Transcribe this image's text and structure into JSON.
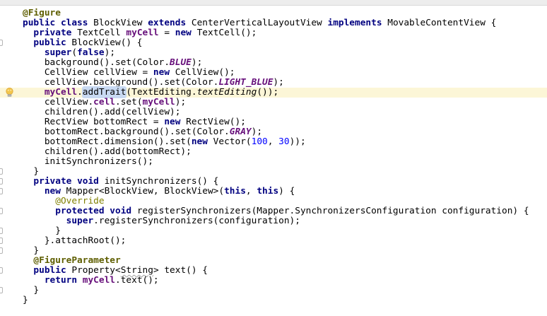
{
  "editor": {
    "language": "java",
    "caret_line_number": 9,
    "colors": {
      "plain": "#000000",
      "keyword": "#000080",
      "field": "#660E7A",
      "static_field_italic": "#660E7A",
      "number": "#0000FF",
      "annotation": "#808000",
      "annotation_strong": "#5E5E00",
      "caret_line_bg": "#FCF6D7",
      "usage_highlight_bg": "#C8D9F2",
      "top_strip_bg": "#EDEDED",
      "editor_bg": "#FFFFFF",
      "bulb_glass": "#F3C64B",
      "bulb_base": "#9B9B9B"
    },
    "gutter": {
      "bulb_icon": "intention-lightbulb",
      "fold_marker_icon": "fold-region-marker"
    },
    "lines": [
      {
        "n": 1,
        "tokens": [
          [
            "@Figure",
            "ab"
          ]
        ]
      },
      {
        "n": 2,
        "tokens": [
          [
            "public ",
            "k"
          ],
          [
            "class ",
            "k"
          ],
          [
            "BlockView ",
            ""
          ],
          [
            "extends ",
            "k"
          ],
          [
            "CenterVerticalLayoutView ",
            ""
          ],
          [
            "implements ",
            "k"
          ],
          [
            "MovableContentView {",
            ""
          ]
        ]
      },
      {
        "n": 3,
        "tokens": [
          [
            "  ",
            ""
          ],
          [
            "private ",
            "k"
          ],
          [
            "TextCell ",
            ""
          ],
          [
            "myCell",
            "f"
          ],
          [
            " = ",
            ""
          ],
          [
            "new ",
            "k"
          ],
          [
            "TextCell();",
            ""
          ]
        ]
      },
      {
        "n": 4,
        "fold": true,
        "tokens": [
          [
            "  ",
            ""
          ],
          [
            "public ",
            "k"
          ],
          [
            "BlockView() {",
            ""
          ]
        ]
      },
      {
        "n": 5,
        "tokens": [
          [
            "    ",
            ""
          ],
          [
            "super",
            "k"
          ],
          [
            "(",
            ""
          ],
          [
            "false",
            "k"
          ],
          [
            ");",
            ""
          ]
        ]
      },
      {
        "n": 6,
        "tokens": [
          [
            "    background().set(Color.",
            ""
          ],
          [
            "BLUE",
            "sf"
          ],
          [
            ");",
            ""
          ]
        ]
      },
      {
        "n": 7,
        "tokens": [
          [
            "    CellView cellView = ",
            ""
          ],
          [
            "new ",
            "k"
          ],
          [
            "CellView();",
            ""
          ]
        ]
      },
      {
        "n": 8,
        "tokens": [
          [
            "    cellView.background().set(Color.",
            ""
          ],
          [
            "LIGHT_BLUE",
            "sf"
          ],
          [
            ");",
            ""
          ]
        ]
      },
      {
        "n": 9,
        "caret": true,
        "bulb": true,
        "tokens": [
          [
            "    ",
            ""
          ],
          [
            "myCell",
            "f"
          ],
          [
            ".",
            ""
          ],
          [
            "addTrait",
            "hl"
          ],
          [
            "(TextEditing.",
            ""
          ],
          [
            "textEditing",
            "sm"
          ],
          [
            "());",
            ""
          ]
        ]
      },
      {
        "n": 10,
        "tokens": [
          [
            "    cellView.",
            ""
          ],
          [
            "cell",
            "f"
          ],
          [
            ".set(",
            ""
          ],
          [
            "myCell",
            "f"
          ],
          [
            ");",
            ""
          ]
        ]
      },
      {
        "n": 11,
        "tokens": [
          [
            "    children().add(cellView);",
            ""
          ]
        ]
      },
      {
        "n": 12,
        "tokens": [
          [
            "    RectView bottomRect = ",
            ""
          ],
          [
            "new ",
            "k"
          ],
          [
            "RectView();",
            ""
          ]
        ]
      },
      {
        "n": 13,
        "tokens": [
          [
            "    bottomRect.background().set(Color.",
            ""
          ],
          [
            "GRAY",
            "sf"
          ],
          [
            ");",
            ""
          ]
        ]
      },
      {
        "n": 14,
        "tokens": [
          [
            "    bottomRect.dimension().set(",
            ""
          ],
          [
            "new ",
            "k"
          ],
          [
            "Vector(",
            ""
          ],
          [
            "100",
            "n"
          ],
          [
            ", ",
            ""
          ],
          [
            "30",
            "n"
          ],
          [
            "));",
            ""
          ]
        ]
      },
      {
        "n": 15,
        "tokens": [
          [
            "    children().add(bottomRect);",
            ""
          ]
        ]
      },
      {
        "n": 16,
        "tokens": [
          [
            "    initSynchronizers();",
            ""
          ]
        ]
      },
      {
        "n": 17,
        "fold": true,
        "tokens": [
          [
            "  }",
            ""
          ]
        ]
      },
      {
        "n": 18,
        "fold": true,
        "tokens": [
          [
            "  ",
            ""
          ],
          [
            "private ",
            "k"
          ],
          [
            "void ",
            "k"
          ],
          [
            "initSynchronizers() {",
            ""
          ]
        ]
      },
      {
        "n": 19,
        "fold": true,
        "tokens": [
          [
            "    ",
            ""
          ],
          [
            "new ",
            "k"
          ],
          [
            "Mapper<BlockView, BlockView>(",
            ""
          ],
          [
            "this",
            "k"
          ],
          [
            ", ",
            ""
          ],
          [
            "this",
            "k"
          ],
          [
            ") {",
            ""
          ]
        ]
      },
      {
        "n": 20,
        "tokens": [
          [
            "      ",
            ""
          ],
          [
            "@Override",
            "a"
          ]
        ]
      },
      {
        "n": 21,
        "fold": true,
        "tokens": [
          [
            "      ",
            ""
          ],
          [
            "protected ",
            "k"
          ],
          [
            "void ",
            "k"
          ],
          [
            "registerSynchronizers(Mapper.SynchronizersConfiguration configuration) {",
            ""
          ]
        ]
      },
      {
        "n": 22,
        "tokens": [
          [
            "        ",
            ""
          ],
          [
            "super",
            "k"
          ],
          [
            ".registerSynchronizers(configuration);",
            ""
          ]
        ]
      },
      {
        "n": 23,
        "fold": true,
        "tokens": [
          [
            "      }",
            ""
          ]
        ]
      },
      {
        "n": 24,
        "fold": true,
        "tokens": [
          [
            "    }.attachRoot();",
            ""
          ]
        ]
      },
      {
        "n": 25,
        "fold": true,
        "tokens": [
          [
            "  }",
            ""
          ]
        ]
      },
      {
        "n": 26,
        "tokens": [
          [
            "  ",
            ""
          ],
          [
            "@FigureParameter",
            "ab"
          ]
        ]
      },
      {
        "n": 27,
        "fold": true,
        "tokens": [
          [
            "  ",
            ""
          ],
          [
            "public ",
            "k"
          ],
          [
            "Property<",
            ""
          ],
          [
            "String",
            "sq"
          ],
          [
            "> text() {",
            ""
          ]
        ]
      },
      {
        "n": 28,
        "tokens": [
          [
            "    ",
            ""
          ],
          [
            "return ",
            "k"
          ],
          [
            "myCell",
            "f"
          ],
          [
            ".text();",
            ""
          ]
        ]
      },
      {
        "n": 29,
        "fold": true,
        "tokens": [
          [
            "  }",
            ""
          ]
        ]
      },
      {
        "n": 30,
        "tokens": [
          [
            "}",
            ""
          ]
        ]
      }
    ]
  }
}
